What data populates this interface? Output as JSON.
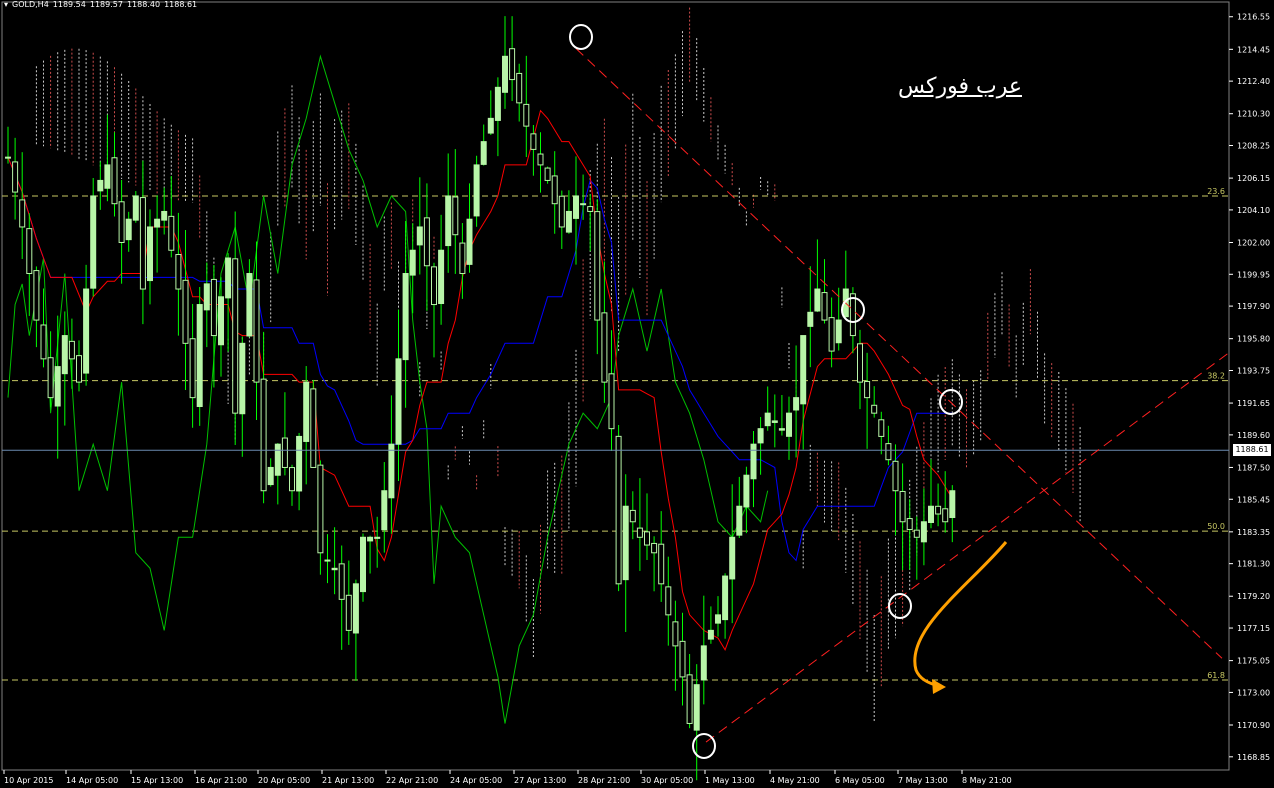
{
  "header": {
    "symbol": "GOLD,H4",
    "ohlc": [
      "1189.54",
      "1189.57",
      "1188.40",
      "1188.61"
    ]
  },
  "brand_text": "عرب فوركس",
  "current_price": "1188.61",
  "colors": {
    "background": "#000000",
    "bull_candle": "#b8f5a8",
    "wick": "#00ff00",
    "chikou": "#00c000",
    "kijun": "#0000ff",
    "tenkan": "#ff0000",
    "cloud": "#ffffff",
    "cloud_red": "#ff6060",
    "fibo": "#c8c864",
    "trendline": "#ff2020",
    "arrow": "#ffa000",
    "axis_text": "#ffffff",
    "marker": "#ffffff"
  },
  "chart_data": {
    "type": "candlestick",
    "symbol": "GOLD",
    "timeframe": "H4",
    "ylim": [
      1168.0,
      1217.5
    ],
    "y_ticks": [
      "1216.55",
      "1214.45",
      "1212.40",
      "1210.30",
      "1208.25",
      "1206.15",
      "1204.10",
      "1202.00",
      "1199.95",
      "1197.90",
      "1195.80",
      "1193.75",
      "1191.65",
      "1189.60",
      "1187.50",
      "1185.45",
      "1183.35",
      "1181.30",
      "1179.20",
      "1177.15",
      "1175.05",
      "1173.00",
      "1170.90",
      "1168.85"
    ],
    "x_labels": [
      "10 Apr 2015",
      "14 Apr 05:00",
      "15 Apr 13:00",
      "16 Apr 21:00",
      "20 Apr 05:00",
      "21 Apr 13:00",
      "22 Apr 21:00",
      "24 Apr 05:00",
      "27 Apr 13:00",
      "28 Apr 21:00",
      "30 Apr 05:00",
      "1 May 13:00",
      "4 May 21:00",
      "6 May 05:00",
      "7 May 13:00",
      "8 May 21:00"
    ],
    "fibonacci_levels": [
      {
        "label": "23.6",
        "price": 1205.0
      },
      {
        "label": "38.2",
        "price": 1193.1
      },
      {
        "label": "50.0",
        "price": 1183.4
      },
      {
        "label": "61.8",
        "price": 1173.8
      }
    ],
    "current_price": 1188.61,
    "trendlines": [
      {
        "name": "descending",
        "from": {
          "x": "28 Apr 00:00",
          "y": 1214.5
        },
        "to": {
          "x": "11 May 01:00",
          "y": 1175.2
        }
      },
      {
        "name": "ascending",
        "from": {
          "x": "1 May 12:00",
          "y": 1169.8
        },
        "to": {
          "x": "11 May 05:00",
          "y": 1194.9
        }
      }
    ],
    "highlighted_points": [
      {
        "x": "28 Apr 05:00",
        "y": 1214.8
      },
      {
        "x": "1 May 08:00",
        "y": 1169.9
      },
      {
        "x": "6 May 05:00",
        "y": 1197.6
      },
      {
        "x": "7 May 09:00",
        "y": 1179.0
      },
      {
        "x": "8 May 09:00",
        "y": 1191.8
      }
    ]
  }
}
